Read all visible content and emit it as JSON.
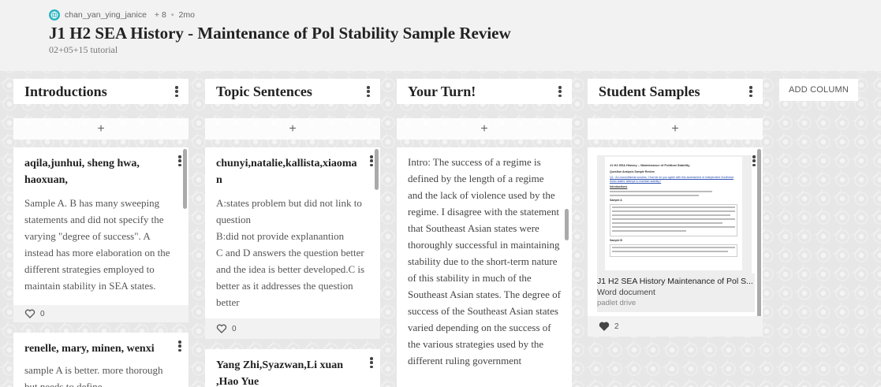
{
  "board": {
    "author": "chan_yan_ying_janice",
    "collaborators": "+ 8",
    "age": "2mo",
    "title": "J1 H2 SEA History - Maintenance of Pol Stability Sample Review",
    "subtitle": "02+05+15 tutorial"
  },
  "add_column_label": "ADD COLUMN",
  "add_post_label": "+",
  "columns": [
    {
      "title": "Introductions",
      "cards": [
        {
          "title": "aqila,junhui, sheng hwa, haoxuan,",
          "text": "Sample A. B has many sweeping statements and did not specify the varying \"degree of success\". A instead has more elaboration on the different strategies employed to maintain stability in SEA states.",
          "likes": "0"
        },
        {
          "title": "renelle, mary, minen, wenxi",
          "text": "sample A is better. more thorough but needs to define"
        }
      ]
    },
    {
      "title": "Topic Sentences",
      "cards": [
        {
          "title": "chunyi,natalie,kallista,xiaoman",
          "text": "A:states problem but did not link to question\nB:did not provide explanantion\nC and D answers the question better and the idea is better developed.C is better as it addresses the question better",
          "likes": "0"
        },
        {
          "title": "Yang Zhi,Syazwan,Li xuan ,Hao Yue",
          "text": ""
        }
      ]
    },
    {
      "title": "Your Turn!",
      "cards": [
        {
          "text": "Intro: The success of a regime is defined by the length of a regime and the lack of violence used by the regime. I disagree with the statement that Southeast Asian states were thoroughly successful in maintaining stability due to the short-term nature of this stability in much of the Southeast Asian states. The degree of success of the Southeast Asian states varied depending on the success of the various strategies used by the different ruling government"
        }
      ]
    },
    {
      "title": "Student Samples",
      "cards": [
        {
          "attachment_title": "J1 H2 SEA History Maintenance of Pol S...",
          "attachment_type": "Word document",
          "attachment_source": "padlet drive",
          "likes": "2"
        }
      ]
    }
  ],
  "doc_preview": {
    "heading": "J1 H2 SEA History – Maintenance of Political Stability",
    "sub": "Question Analysis Sample Review",
    "q": "Q1: 'An unconditional success.' How far do you agree with this assessment of independent Southeast Asian states' attempt to maintain stability?",
    "section": "Introductions",
    "sample_a": "Sample A",
    "sample_b": "Sample B"
  },
  "colors": {
    "accent": "#2bb3c0",
    "header_bg": "#f2f2f2",
    "card_bg": "#ffffff"
  }
}
